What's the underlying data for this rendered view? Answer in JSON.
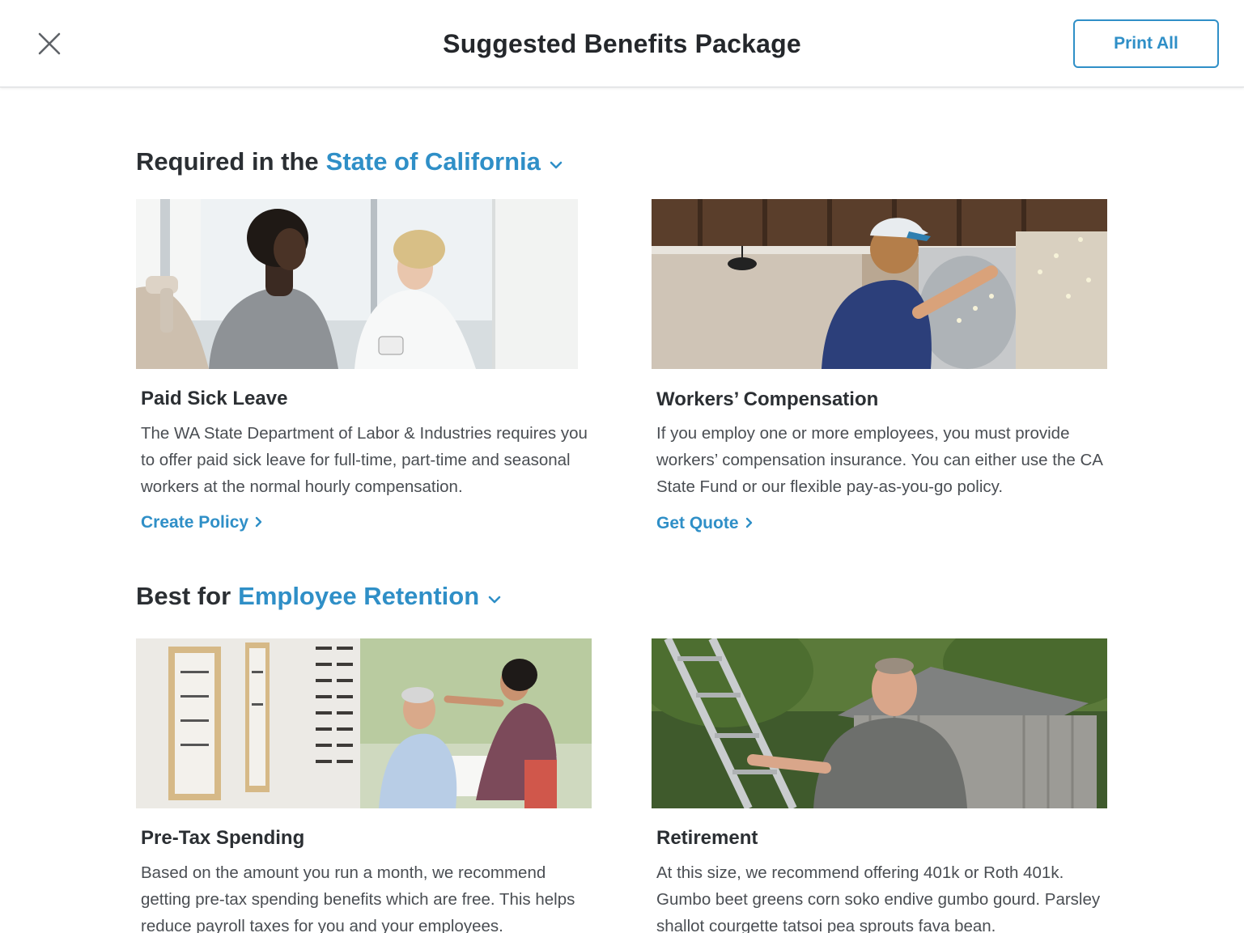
{
  "header": {
    "title": "Suggested Benefits Package",
    "print_label": "Print All"
  },
  "sections": [
    {
      "prefix": "Required in the",
      "selector": "State of California",
      "cards": [
        {
          "title": "Paid Sick Leave",
          "description": "The WA State Department of Labor & Industries requires you to offer paid sick leave for full-time, part-time and seasonal workers at the normal hourly compensation.",
          "link": "Create Policy",
          "image": "doctor-consultation-photo"
        },
        {
          "title": "Workers’ Compensation",
          "description": "If you employ one or more employees, you must provide workers’ compensation insurance. You can either use the CA State Fund or our flexible pay-as-you-go policy.",
          "link": "Get Quote",
          "image": "brewery-worker-photo"
        }
      ]
    },
    {
      "prefix": "Best for",
      "selector": "Employee Retention",
      "cards": [
        {
          "title": "Pre-Tax Spending",
          "description": "Based on the amount you run a month, we recommend getting pre-tax spending benefits which are free. This helps reduce payroll taxes for you and your employees.",
          "image": "optometrist-fitting-photo"
        },
        {
          "title": "Retirement",
          "description": "At this size, we recommend offering 401k or Roth 401k. Gumbo beet greens corn soko endive gumbo gourd. Parsley shallot courgette tatsoi pea sprouts fava bean.",
          "image": "man-with-ladder-photo"
        }
      ]
    }
  ],
  "colors": {
    "accent": "#2f8fc7",
    "heading": "#2b2f33",
    "body_text": "#4a4e53"
  },
  "icons": {
    "close": "close-icon",
    "chevron": "chevron-down-icon",
    "arrow": "chevron-right-icon"
  }
}
